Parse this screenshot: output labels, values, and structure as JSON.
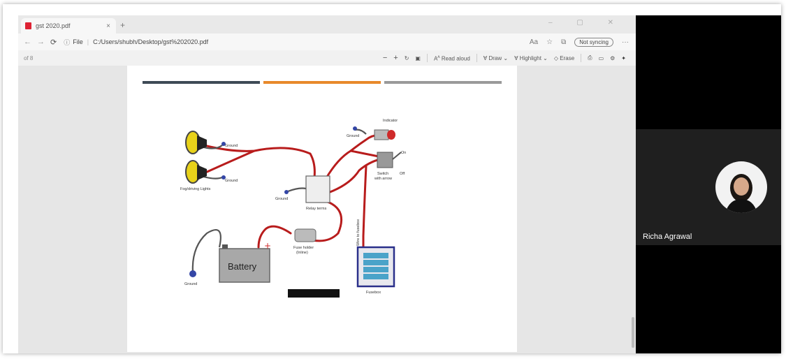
{
  "browser": {
    "tab_title": "gst 2020.pdf",
    "tab_close": "×",
    "new_tab": "+",
    "url_prefix": "File",
    "url": "C:/Users/shubh/Desktop/gst%202020.pdf",
    "sync_label": "Not syncing",
    "window_controls": "– ▢ ✕"
  },
  "pdf_toolbar": {
    "page": "of 8",
    "read_aloud": "Read aloud",
    "draw": "Draw",
    "highlight": "Highlight",
    "erase": "Erase"
  },
  "diagram": {
    "labels": {
      "ground_top": "Ground",
      "ground_mid": "Ground",
      "ground_relay": "Ground",
      "ground_switch": "Ground",
      "ground_battery": "Ground",
      "fog_lights": "Fog/driving Lights",
      "indicator": "Indicator",
      "on": "On",
      "off": "Off",
      "switch": "Switch",
      "switch_sub": "with arrow",
      "relay": "Relay terms",
      "fuse_holder": "Fuse holder",
      "fuse_holder_sub": "(Inline)",
      "fusebox": "Fusebox",
      "battery": "Battery",
      "wire_note": "Wire to fusebox"
    },
    "colors": {
      "wire": "#b81c1c",
      "lamp": "#e8d21a",
      "fusebox_border": "#2a2f8a"
    }
  },
  "participant": {
    "name": "Richa Agrawal"
  }
}
